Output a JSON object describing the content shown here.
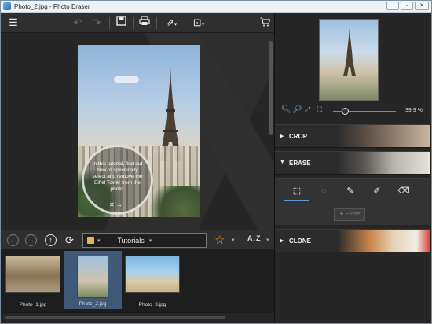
{
  "window": {
    "title": "Photo_2.jpg - Photo Eraser",
    "controls": [
      "–",
      "▫",
      "✕"
    ]
  },
  "toolbar": {
    "icons": [
      "menu-icon",
      "undo-icon",
      "redo-icon",
      "save-icon",
      "print-icon",
      "share-icon",
      "resize-icon"
    ],
    "cart_icon": "🛒"
  },
  "canvas": {
    "tutorial_text": "In this tutorial, find out how to specifically select and remove the Eiffel Tower from the photo.",
    "tutorial_nav": "✕  →"
  },
  "filmstrip_bar": {
    "folder": "Tutorials",
    "sort_label": "A↓Z"
  },
  "thumbnails": [
    {
      "label": "Photo_1.jpg",
      "selected": false
    },
    {
      "label": "Photo_2.jpg",
      "selected": true
    },
    {
      "label": "Photo_3.jpg",
      "selected": false
    }
  ],
  "right_panel": {
    "zoom_value": "39,9 %",
    "zoom_fraction": 0.15,
    "sections": {
      "crop": "CROP",
      "erase": "ERASE",
      "clone": "CLONE"
    },
    "erase_button": "Erase"
  },
  "colors": {
    "accent": "#5b9bd5",
    "star": "#f0a400",
    "selected_thumb": "#3f5a78"
  }
}
